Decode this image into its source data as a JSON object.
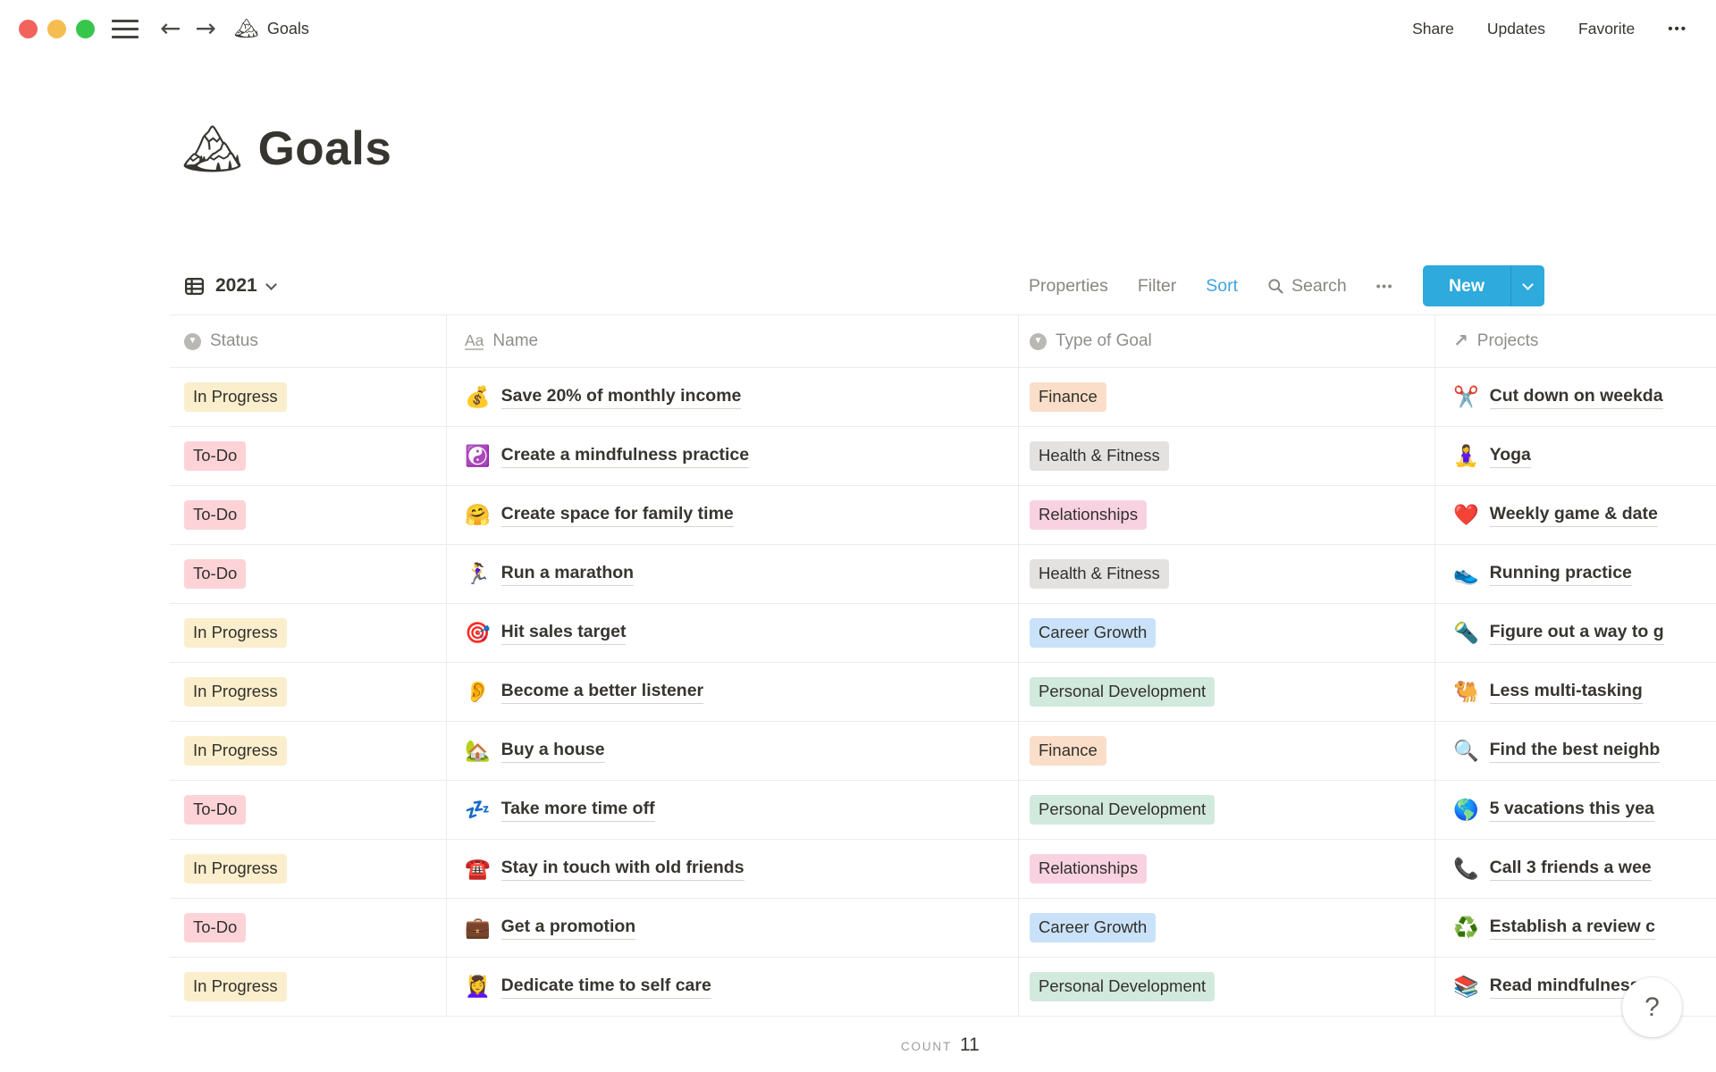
{
  "titlebar": {
    "page_emoji": "🏔",
    "page_title": "Goals",
    "actions": {
      "share": "Share",
      "updates": "Updates",
      "favorite": "Favorite",
      "more": "•••"
    }
  },
  "page": {
    "emoji": "🏔",
    "title": "Goals"
  },
  "toolbar": {
    "view_name": "2021",
    "properties": "Properties",
    "filter": "Filter",
    "sort": "Sort",
    "search": "Search",
    "more": "•••",
    "new_label": "New"
  },
  "table": {
    "columns": [
      {
        "label": "Status",
        "icon": "select-icon"
      },
      {
        "label": "Name",
        "icon": "text-icon"
      },
      {
        "label": "Type of Goal",
        "icon": "select-icon"
      },
      {
        "label": "Projects",
        "icon": "relation-icon"
      }
    ],
    "rows": [
      {
        "status": "In Progress",
        "status_color": "yellow",
        "emoji": "💰",
        "name": "Save 20% of monthly income",
        "type": "Finance",
        "type_color": "orange",
        "project_emoji": "✂️",
        "project": "Cut down on weekda"
      },
      {
        "status": "To-Do",
        "status_color": "red",
        "emoji": "☯️",
        "name": "Create a mindfulness practice",
        "type": "Health & Fitness",
        "type_color": "gray",
        "project_emoji": "🧘‍♀️",
        "project": "Yoga"
      },
      {
        "status": "To-Do",
        "status_color": "red",
        "emoji": "🤗",
        "name": "Create space for family time",
        "type": "Relationships",
        "type_color": "pink",
        "project_emoji": "❤️",
        "project": "Weekly game & date"
      },
      {
        "status": "To-Do",
        "status_color": "red",
        "emoji": "🏃‍♀️",
        "name": "Run a marathon",
        "type": "Health & Fitness",
        "type_color": "gray",
        "project_emoji": "👟",
        "project": "Running practice"
      },
      {
        "status": "In Progress",
        "status_color": "yellow",
        "emoji": "🎯",
        "name": "Hit sales target",
        "type": "Career Growth",
        "type_color": "blue",
        "project_emoji": "🔦",
        "project": "Figure out a way to g"
      },
      {
        "status": "In Progress",
        "status_color": "yellow",
        "emoji": "👂",
        "name": "Become a better listener",
        "type": "Personal Development",
        "type_color": "green",
        "project_emoji": "🐫",
        "project": "Less multi-tasking"
      },
      {
        "status": "In Progress",
        "status_color": "yellow",
        "emoji": "🏡",
        "name": "Buy a house",
        "type": "Finance",
        "type_color": "orange",
        "project_emoji": "🔍",
        "project": "Find the best neighb"
      },
      {
        "status": "To-Do",
        "status_color": "red",
        "emoji": "💤",
        "name": "Take more time off",
        "type": "Personal Development",
        "type_color": "green",
        "project_emoji": "🌎",
        "project": "5 vacations this yea"
      },
      {
        "status": "In Progress",
        "status_color": "yellow",
        "emoji": "☎️",
        "name": "Stay in touch with old friends",
        "type": "Relationships",
        "type_color": "pink",
        "project_emoji": "📞",
        "project": "Call 3 friends a wee"
      },
      {
        "status": "To-Do",
        "status_color": "red",
        "emoji": "💼",
        "name": "Get a promotion",
        "type": "Career Growth",
        "type_color": "blue",
        "project_emoji": "♻️",
        "project": "Establish a review c"
      },
      {
        "status": "In Progress",
        "status_color": "yellow",
        "emoji": "💆‍♀️",
        "name": "Dedicate time to self care",
        "type": "Personal Development",
        "type_color": "green",
        "project_emoji": "📚",
        "project": "Read mindfulness b"
      }
    ]
  },
  "footer": {
    "count_label": "COUNT",
    "count_value": "11"
  },
  "help": {
    "label": "?"
  },
  "colors": {
    "accent_button": "#2EAADC",
    "sort_active": "#3FA3E2",
    "badges": {
      "yellow": "#FBEECC",
      "red": "#FDD3D7",
      "orange": "#FADEC9",
      "gray": "#E3E2E0",
      "pink": "#F9D2E1",
      "blue": "#C9E2F9",
      "green": "#D2E9DD"
    }
  }
}
